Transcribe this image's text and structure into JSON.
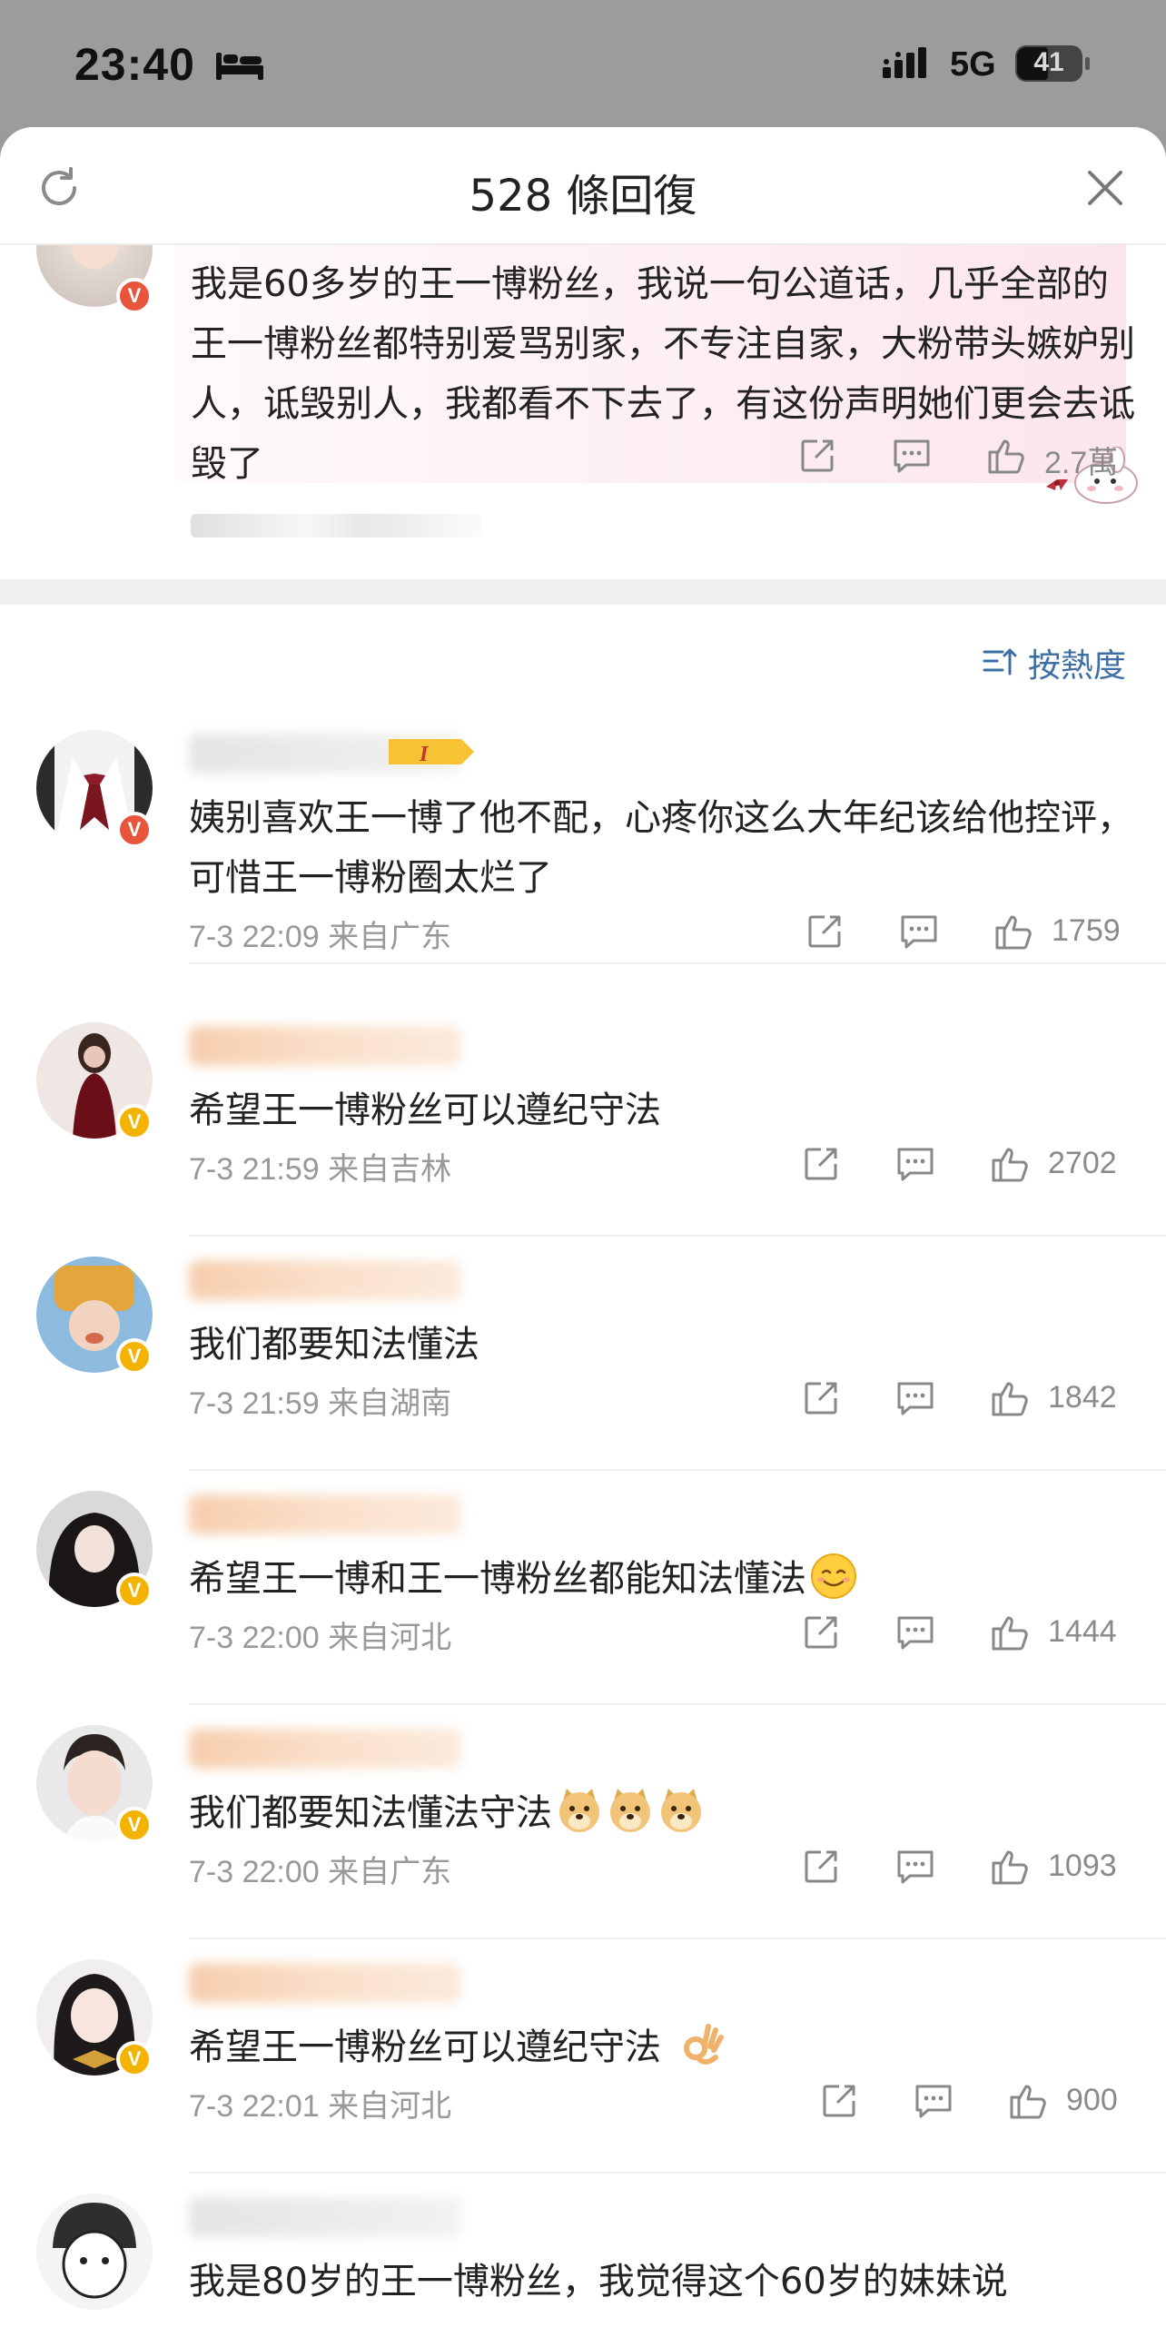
{
  "status_bar": {
    "time": "23:40",
    "network": "5G",
    "battery": "41"
  },
  "header": {
    "title": "528 條回復"
  },
  "pinned": {
    "text": "我是60多岁的王一博粉丝，我说一句公道话，几乎全部的王一博粉丝都特别爱骂别家，不专注自家，大粉带头嫉妒别人，诋毁别人，我都看不下去了，有这份声明她们更会去诋毁了",
    "likes": "2.7萬"
  },
  "sort": {
    "label": "按熱度"
  },
  "comments": [
    {
      "text": "姨别喜欢王一博了他不配，心疼你这么大年纪该给他控评，可惜王一博粉圈太烂了",
      "meta": "7-3 22:09  来自广东",
      "likes": "1759"
    },
    {
      "text": "希望王一博粉丝可以遵纪守法",
      "meta": "7-3 21:59  来自吉林",
      "likes": "2702"
    },
    {
      "text": "我们都要知法懂法",
      "meta": "7-3 21:59  来自湖南",
      "likes": "1842"
    },
    {
      "text": "希望王一博和王一博粉丝都能知法懂法",
      "meta": "7-3 22:00  来自河北",
      "likes": "1444"
    },
    {
      "text": "我们都要知法懂法守法",
      "meta": "7-3 22:00  来自广东",
      "likes": "1093"
    },
    {
      "text": "希望王一博粉丝可以遵纪守法",
      "meta": "7-3 22:01  来自河北",
      "likes": "900"
    },
    {
      "text": "我是80岁的王一博粉丝，我觉得这个60岁的妹妹说"
    }
  ]
}
